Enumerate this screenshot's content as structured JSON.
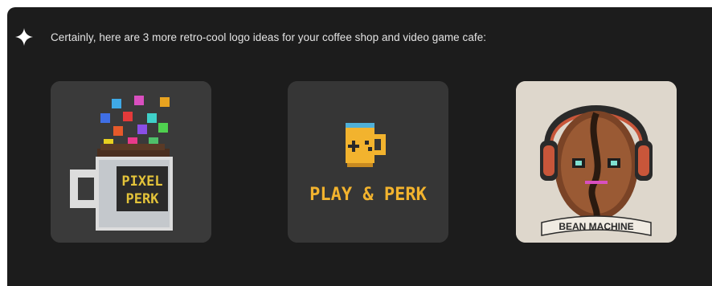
{
  "response": {
    "icon": "sparkle-icon",
    "text": "Certainly, here are 3 more retro-cool logo ideas for your coffee shop and video game cafe:"
  },
  "logos": [
    {
      "title_line1": "PIXEL",
      "title_line2": "PERK",
      "icon": "pixel-mug-icon",
      "accent": "#e3c33a"
    },
    {
      "title": "PLAY & PERK",
      "icon": "gamepad-mug-icon",
      "accent": "#f2b32e"
    },
    {
      "title": "BEAN MACHINE",
      "icon": "coffee-bean-headphones-icon",
      "accent": "#c8563a"
    }
  ]
}
